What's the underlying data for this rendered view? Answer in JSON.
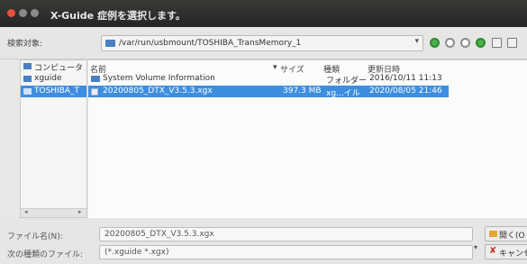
{
  "window": {
    "app_name": "X-Guide",
    "title": "症例を選択します。"
  },
  "toolbar": {
    "look_in_label": "検索対象:",
    "path": "/var/run/usbmount/TOSHIBA_TransMemory_1"
  },
  "sidebar": {
    "items": [
      {
        "label": "コンピュータ",
        "icon": "computer-icon"
      },
      {
        "label": "xguide",
        "icon": "folder-icon"
      },
      {
        "label": "TOSHIBA_T",
        "icon": "drive-icon"
      }
    ]
  },
  "file_list": {
    "columns": [
      "名前",
      "サイズ",
      "種類",
      "更新日時"
    ],
    "rows": [
      {
        "name": "System Volume Information",
        "size": "",
        "type": "フォルダー",
        "modified": "2016/10/11 11:13",
        "icon": "folder-icon"
      },
      {
        "name": "20200805_DTX_V3.5.3.xgx",
        "size": "397.3 MB",
        "type": "xg...イル",
        "modified": "2020/08/05 21:46",
        "icon": "file-icon"
      }
    ]
  },
  "bottom": {
    "filename_label": "ファイル名(N):",
    "filename_value": "20200805_DTX_V3.5.3.xgx",
    "filetype_label": "次の種類のファイル:",
    "filetype_value": "(*.xguide *.xgx)",
    "open_label": "開く(O",
    "cancel_label": "キャンセ"
  }
}
